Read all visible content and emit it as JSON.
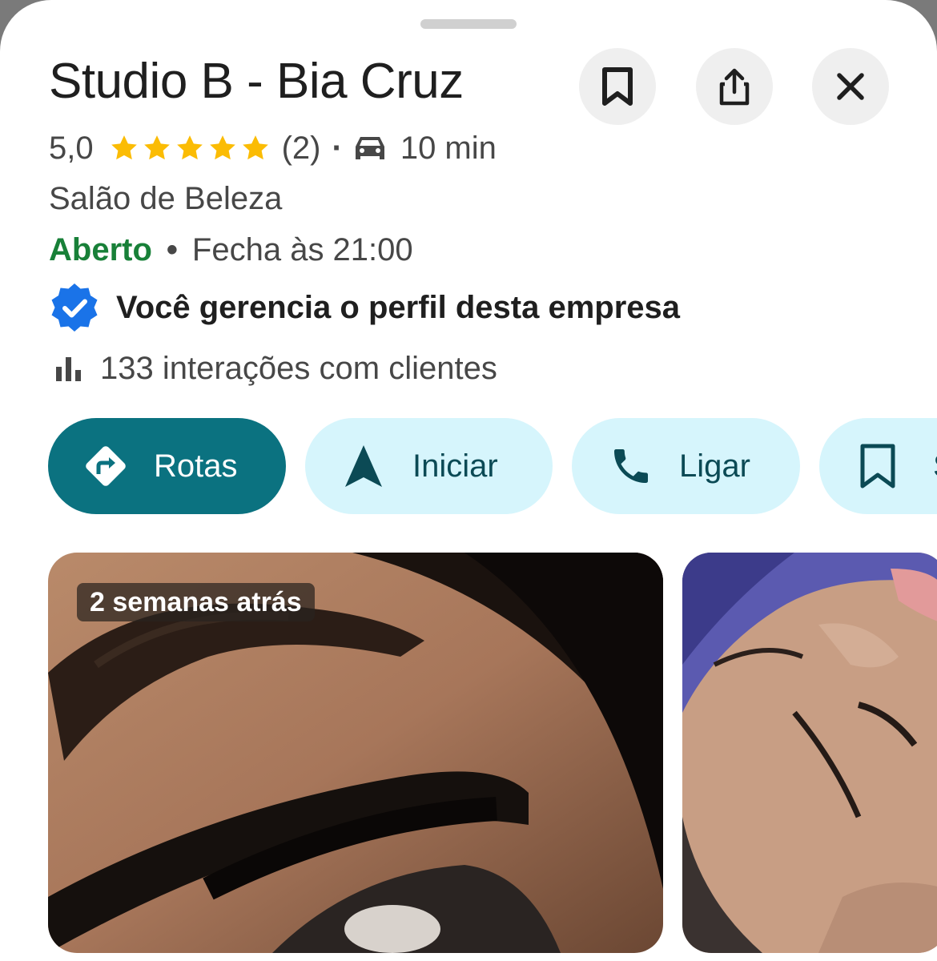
{
  "place": {
    "name": "Studio B - Bia Cruz",
    "rating": "5,0",
    "stars": 5,
    "review_count": "(2)",
    "separator": "·",
    "drive_time": "10 min",
    "category": "Salão de Beleza",
    "status": "Aberto",
    "hours_separator": "•",
    "closes": "Fecha às 21:00",
    "verified_text": "Você gerencia o perfil desta empresa",
    "interactions": "133 interações com clientes"
  },
  "header_actions": [
    {
      "icon": "bookmark-icon"
    },
    {
      "icon": "share-icon"
    },
    {
      "icon": "close-icon"
    }
  ],
  "actions": [
    {
      "label": "Rotas",
      "icon": "directions-icon"
    },
    {
      "label": "Iniciar",
      "icon": "navigation-arrow-icon"
    },
    {
      "label": "Ligar",
      "icon": "phone-icon"
    },
    {
      "label": "S",
      "icon": "bookmark-icon"
    }
  ],
  "photos": [
    {
      "badge": "2 semanas atrás",
      "subject": "eyelash extensions close-up"
    },
    {
      "subject": "client lying with eyes closed"
    }
  ],
  "colors": {
    "accent": "#0b7280",
    "chip_bg": "#d6f5fc",
    "open_green": "#188038",
    "star": "#fbbc04",
    "verified_blue": "#1a73e8"
  }
}
